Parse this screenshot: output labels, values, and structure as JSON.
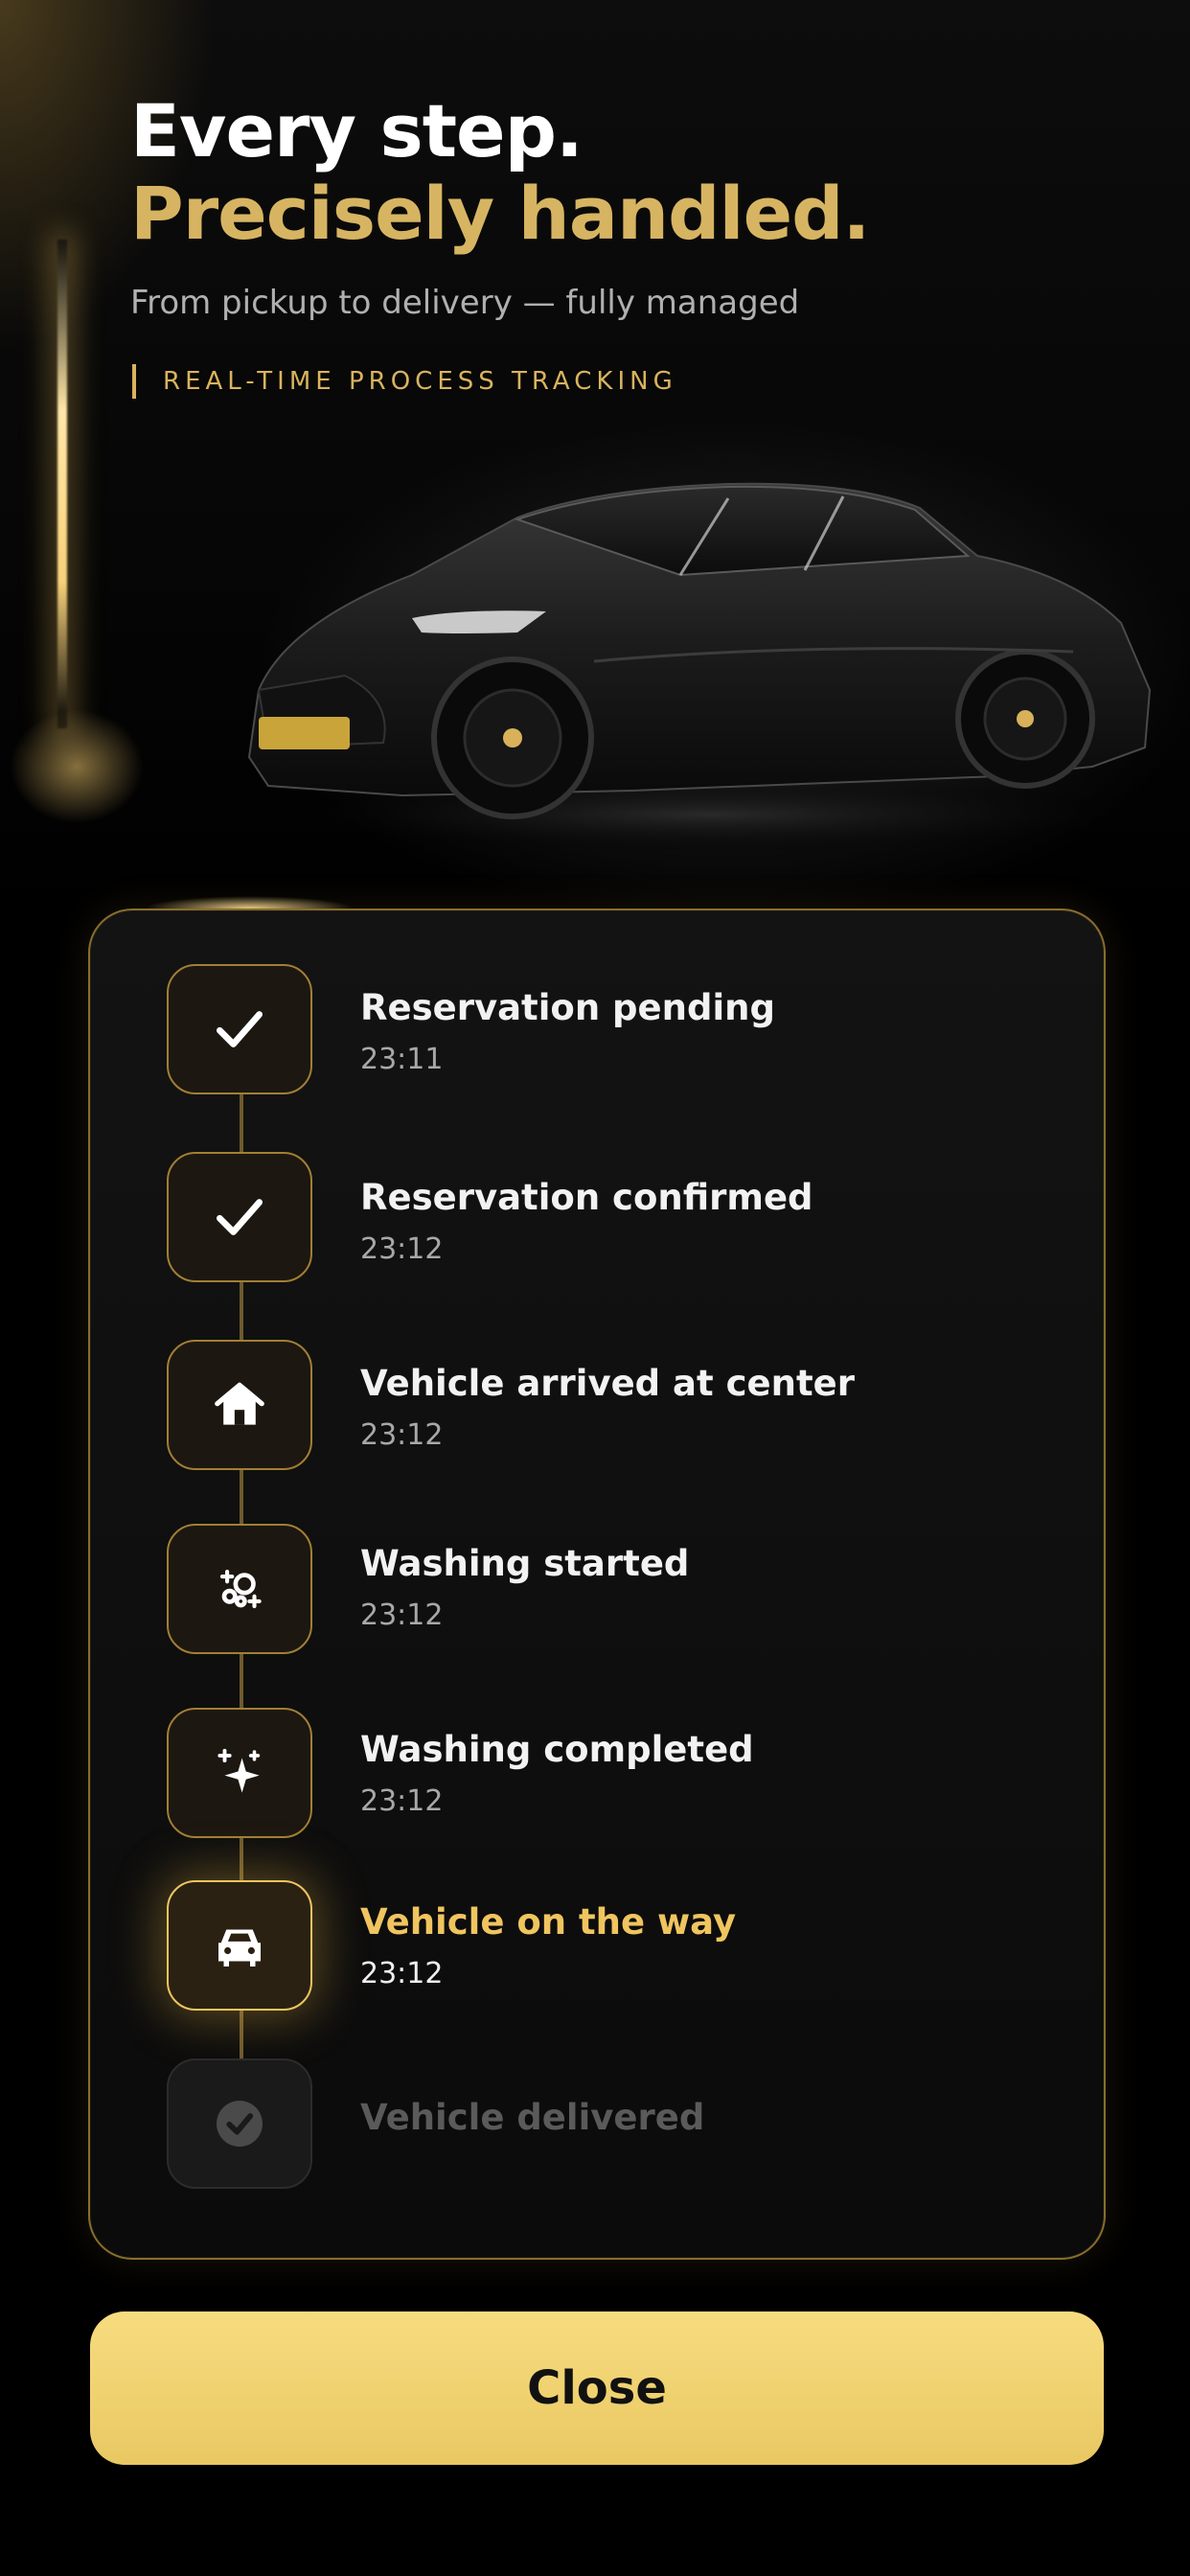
{
  "hero": {
    "headline_line1": "Every step.",
    "headline_line2": "Precisely handled.",
    "subtitle": "From pickup to delivery — fully managed",
    "tag": "REAL-TIME PROCESS TRACKING"
  },
  "colors": {
    "accent_gold": "#d6b462",
    "active_gold": "#f0c55f",
    "button_gold": "#f0d06e",
    "background": "#000000",
    "card_border": "#8a6d2c"
  },
  "steps": [
    {
      "title": "Reservation pending",
      "time": "23:11",
      "icon": "check-icon",
      "state": "done"
    },
    {
      "title": "Reservation confirmed",
      "time": "23:12",
      "icon": "check-icon",
      "state": "done"
    },
    {
      "title": "Vehicle arrived at center",
      "time": "23:12",
      "icon": "home-icon",
      "state": "done"
    },
    {
      "title": "Washing started",
      "time": "23:12",
      "icon": "bubbles-icon",
      "state": "done"
    },
    {
      "title": "Washing completed",
      "time": "23:12",
      "icon": "sparkle-icon",
      "state": "done"
    },
    {
      "title": "Vehicle on the way",
      "time": "23:12",
      "icon": "car-icon",
      "state": "active"
    },
    {
      "title": "Vehicle delivered",
      "time": "",
      "icon": "check-circle-icon",
      "state": "pending"
    }
  ],
  "footer": {
    "close_label": "Close"
  }
}
